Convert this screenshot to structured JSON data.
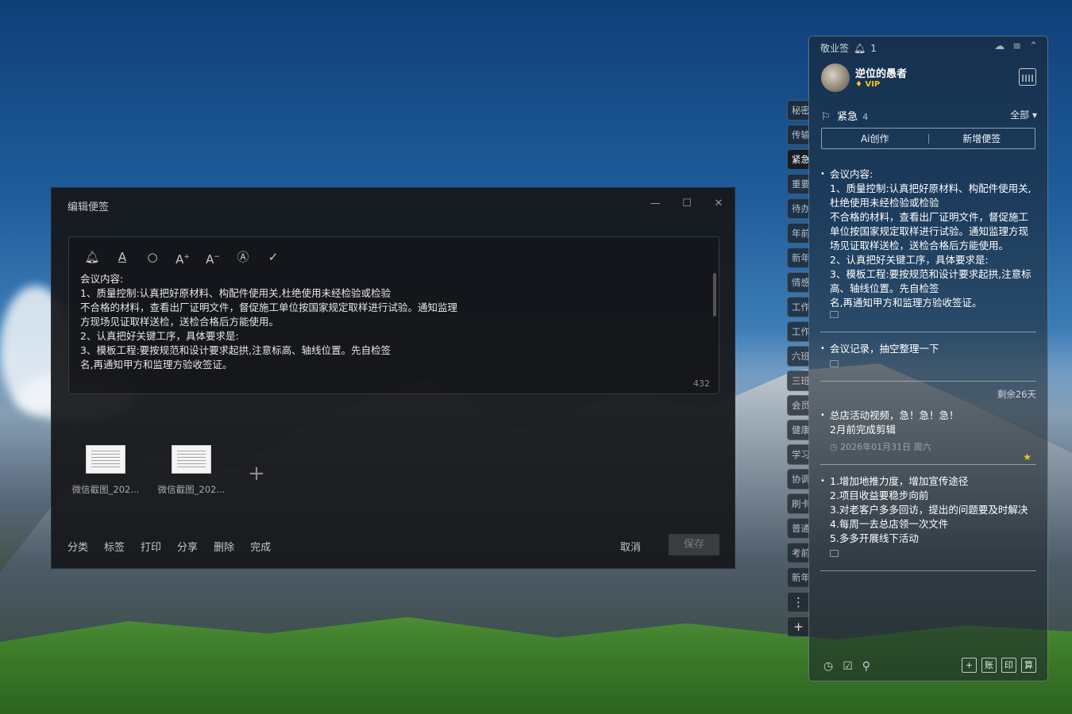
{
  "editor": {
    "title": "编辑便签",
    "win_minimize": "—",
    "win_maximize": "☐",
    "win_close": "✕",
    "toolbar": [
      "bell",
      "font-color",
      "search",
      "font-increase",
      "font-decrease",
      "auto-format",
      "check"
    ],
    "content_lines": [
      "会议内容:",
      "1、质量控制:认真把好原材料、构配件使用关,杜绝使用未经检验或检验",
      "不合格的材料，查看出厂证明文件，督促施工单位按国家规定取样进行试验。通知监理",
      "方现场见证取样送检，送检合格后方能使用。",
      "2、认真把好关键工序，具体要求是:",
      "3、模板工程:要按规范和设计要求起拱,注意标高、轴线位置。先自检签",
      "名,再通知甲方和监理方验收签证。"
    ],
    "char_count": "432",
    "attachments": [
      {
        "name": "微信截图_202..."
      },
      {
        "name": "微信截图_202..."
      }
    ],
    "add_attachment": "+",
    "footer_actions": [
      "分类",
      "标签",
      "打印",
      "分享",
      "删除",
      "完成"
    ],
    "cancel_label": "取消",
    "save_label": "保存"
  },
  "side_tabs": [
    "秘密",
    "传输",
    "紧急",
    "重要",
    "待办",
    "年前",
    "新年",
    "情感",
    "工作",
    "工作",
    "六班",
    "三班",
    "会员",
    "健康",
    "学习",
    "协调",
    "刷卡",
    "普通",
    "考前",
    "新年"
  ],
  "side_tabs_active": "紧急",
  "side_tab_more": "⋮",
  "side_tab_add": "+",
  "panel": {
    "app_name": "敬业签",
    "notification_count": "1",
    "username": "逆位的愚者",
    "vip_label": "VIP",
    "category": "紧急",
    "category_count": "4",
    "filter": "全部",
    "ai_label": "Ai创作",
    "new_note_label": "新增便签",
    "notes": [
      {
        "lines": [
          "会议内容:",
          "1、质量控制:认真把好原材料、构配件使用关,杜绝使用未经检验或检验",
          "不合格的材料，查看出厂证明文件，督促施工单位按国家规定取样进行试验。通知监理方现场见证取样送检，送检合格后方能使用。",
          "2、认真把好关键工序，具体要求是:",
          "3、模板工程:要按规范和设计要求起拱,注意标高、轴线位置。先自检签",
          "名,再通知甲方和监理方验收签证。"
        ]
      },
      {
        "lines": [
          "会议记录，抽空整理一下"
        ]
      },
      {
        "remaining": "剩余26天",
        "lines": [
          "总店活动视频，急！急！急！",
          "2月前完成剪辑"
        ],
        "meta": "2026年01月31日 周六"
      },
      {
        "lines": [
          "1.增加地推力度，增加宣传途径",
          "2.项目收益要稳步向前",
          "3.对老客户多多回访，提出的问题要及时解决",
          "4.每周一去总店领一次文件",
          "5.多多开展线下活动"
        ]
      }
    ],
    "bottom_buttons": [
      "账",
      "印",
      "算"
    ]
  }
}
